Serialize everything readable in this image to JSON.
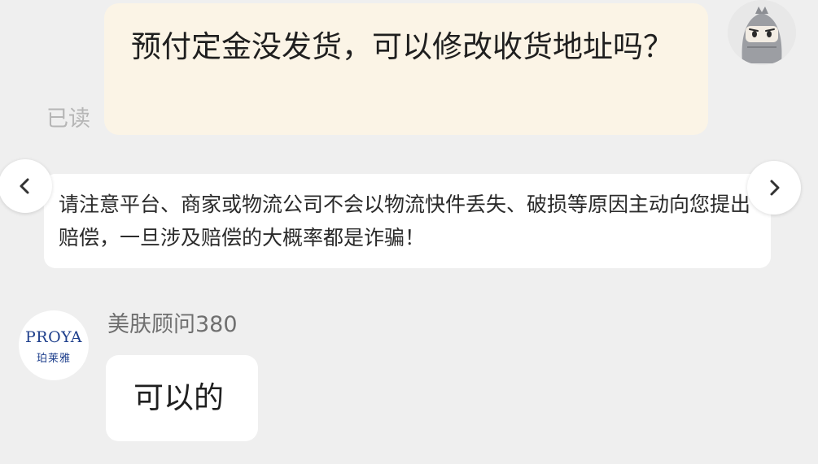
{
  "messages": {
    "outgoing": {
      "text": "预付定金没发货，可以修改收货地址吗？",
      "read_status": "已读"
    },
    "notice": {
      "text": "请注意平台、商家或物流公司不会以物流快件丢失、破损等原因主动向您提出赔偿，一旦涉及赔偿的大概率都是诈骗！"
    },
    "incoming": {
      "sender_name": "美肤顾问380",
      "text": "可以的"
    }
  },
  "agent_avatar": {
    "brand_en": "PROYA",
    "brand_cn": "珀莱雅"
  },
  "nav": {
    "prev_icon": "chevron-left-icon",
    "next_icon": "chevron-right-icon"
  },
  "colors": {
    "background": "#efefef",
    "outgoing_bubble": "#fbf4e6",
    "incoming_bubble": "#ffffff",
    "brand_blue": "#1e3f8c"
  }
}
